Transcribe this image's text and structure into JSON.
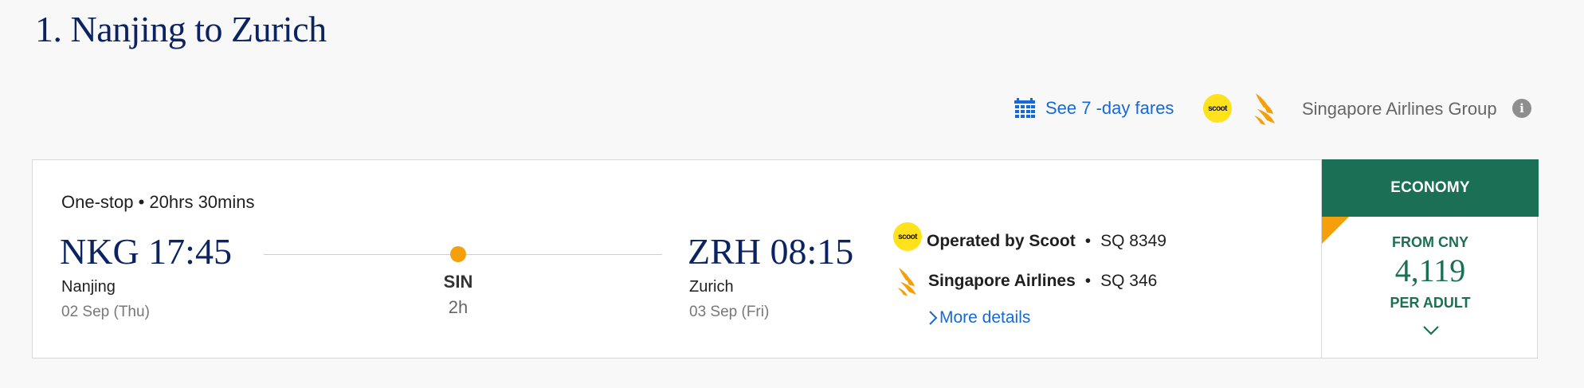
{
  "page": {
    "title": "1. Nanjing to Zurich"
  },
  "toolbar": {
    "seven_day_label": "See 7 -day fares",
    "scoot_logo_text": "scoot",
    "airline_group_label": "Singapore Airlines Group",
    "info_icon_text": "i"
  },
  "flight": {
    "summary": "One-stop • 20hrs 30mins",
    "departure": {
      "code_time": "NKG 17:45",
      "city": "Nanjing",
      "date": "02 Sep (Thu)"
    },
    "arrival": {
      "code_time": "ZRH 08:15",
      "city": "Zurich",
      "date": "03 Sep (Fri)"
    },
    "stopover": {
      "code": "SIN",
      "duration": "2h"
    },
    "operators": [
      {
        "logo_text": "scoot",
        "name": "Operated by Scoot",
        "sep": "•",
        "flight_no": "SQ 8349"
      },
      {
        "name": "Singapore Airlines",
        "sep": "•",
        "flight_no": "SQ 346"
      }
    ],
    "more_details_label": "More details"
  },
  "fare": {
    "cabin": "ECONOMY",
    "from_label": "FROM CNY",
    "amount": "4,119",
    "per_label": "PER ADULT"
  },
  "colors": {
    "brand_navy": "#0b2360",
    "link_blue": "#1769d6",
    "economy_green": "#1b6f54",
    "accent_orange": "#f5a00a",
    "scoot_yellow": "#ffe11c"
  },
  "icons": {
    "calendar": "calendar-icon",
    "info": "info-icon",
    "chevron_right": "chevron-right-icon",
    "chevron_down": "chevron-down-icon",
    "sia_bird": "singapore-airlines-logo"
  }
}
